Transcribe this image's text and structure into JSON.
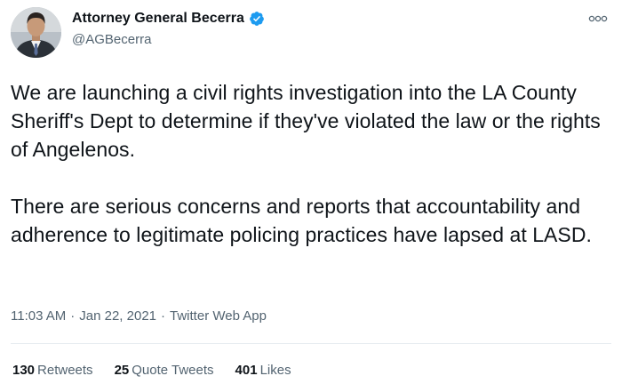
{
  "author": {
    "display_name": "Attorney General Becerra",
    "handle": "@AGBecerra",
    "verified_icon": "verified-badge-icon",
    "verified_color": "#1d9bf0"
  },
  "menu": {
    "icon": "more-options-icon"
  },
  "tweet": {
    "paragraphs": [
      "We are launching a civil rights investigation into the LA County Sheriff's Dept to determine if they've violated the law or the rights of Angelenos.",
      "There are serious concerns and reports that accountability and adherence to legitimate policing practices have lapsed at LASD."
    ]
  },
  "meta": {
    "time": "11:03 AM",
    "separator1": "·",
    "date": "Jan 22, 2021",
    "separator2": "·",
    "source": "Twitter Web App"
  },
  "stats": {
    "retweets": {
      "count": "130",
      "label": "Retweets"
    },
    "quotes": {
      "count": "25",
      "label": "Quote Tweets"
    },
    "likes": {
      "count": "401",
      "label": "Likes"
    }
  },
  "colors": {
    "text": "#0f1419",
    "secondary": "#536471",
    "divider": "#e6ecf0"
  }
}
